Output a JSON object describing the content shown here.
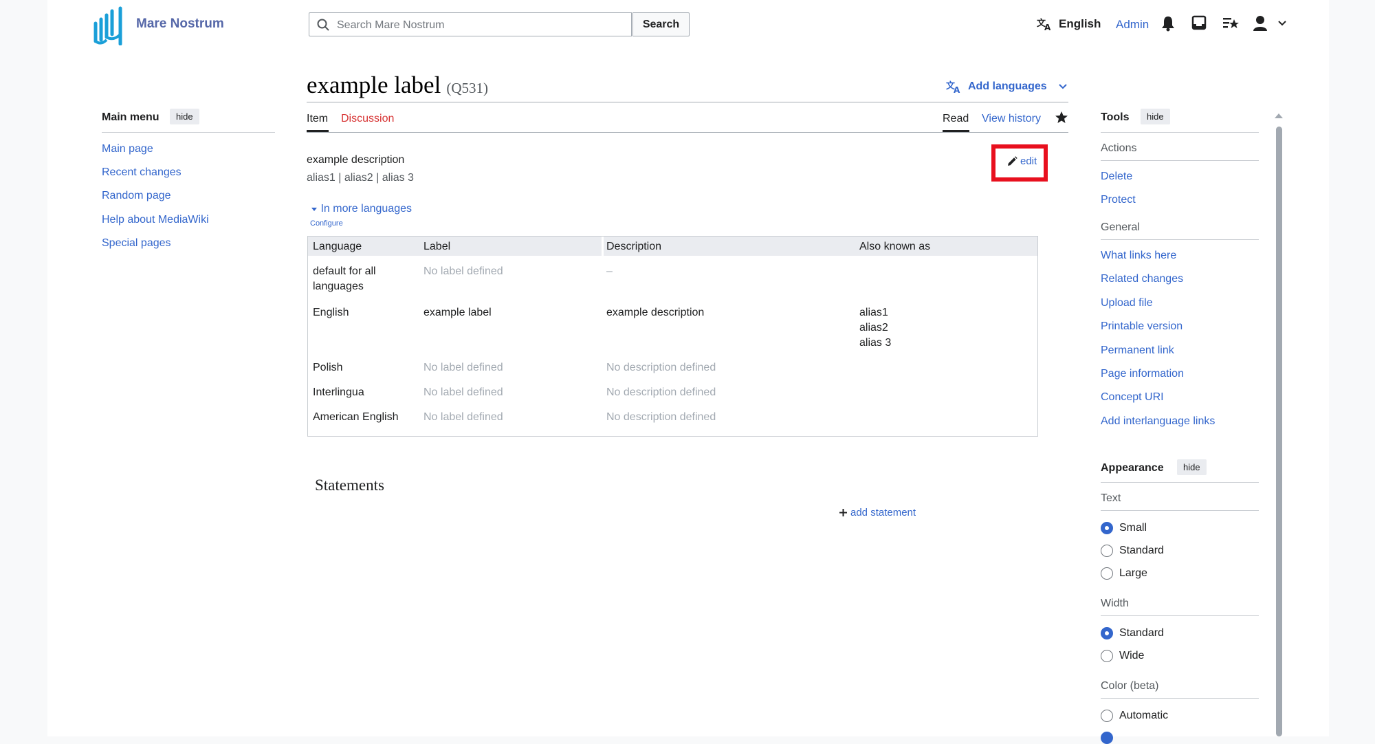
{
  "header": {
    "site_name": "Mare Nostrum",
    "search_placeholder": "Search Mare Nostrum",
    "search_button": "Search",
    "language": "English",
    "user": "Admin"
  },
  "main_menu": {
    "title": "Main menu",
    "hide": "hide",
    "items": [
      "Main page",
      "Recent changes",
      "Random page",
      "Help about MediaWiki",
      "Special pages"
    ]
  },
  "page": {
    "title": "example label",
    "qid": "(Q531)",
    "add_languages": "Add languages",
    "tabs": {
      "item": "Item",
      "discussion": "Discussion",
      "read": "Read",
      "history": "View history"
    },
    "description": "example description",
    "aliases": "alias1 | alias2 | alias 3",
    "edit": "edit",
    "more_languages": "In more languages",
    "configure": "Configure"
  },
  "lang_table": {
    "headers": [
      "Language",
      "Label",
      "Description",
      "Also known as"
    ],
    "rows": [
      {
        "language": "default for all languages",
        "label": "No label defined",
        "description": "–",
        "aliases": ""
      },
      {
        "language": "English",
        "label": "example label",
        "description": "example description",
        "aliases": "alias1\nalias2\nalias 3"
      },
      {
        "language": "Polish",
        "label": "No label defined",
        "description": "No description defined",
        "aliases": ""
      },
      {
        "language": "Interlingua",
        "label": "No label defined",
        "description": "No description defined",
        "aliases": ""
      },
      {
        "language": "American English",
        "label": "No label defined",
        "description": "No description defined",
        "aliases": ""
      }
    ]
  },
  "statements": {
    "heading": "Statements",
    "add": "add statement"
  },
  "tools": {
    "title": "Tools",
    "hide": "hide",
    "actions_heading": "Actions",
    "actions": [
      "Delete",
      "Protect"
    ],
    "general_heading": "General",
    "general": [
      "What links here",
      "Related changes",
      "Upload file",
      "Printable version",
      "Permanent link",
      "Page information",
      "Concept URI",
      "Add interlanguage links"
    ]
  },
  "appearance": {
    "title": "Appearance",
    "hide": "hide",
    "text_heading": "Text",
    "text_options": [
      "Small",
      "Standard",
      "Large"
    ],
    "text_selected": "Small",
    "width_heading": "Width",
    "width_options": [
      "Standard",
      "Wide"
    ],
    "width_selected": "Standard",
    "color_heading": "Color (beta)",
    "color_options": [
      "Automatic"
    ]
  },
  "colors": {
    "link": "#3366cc",
    "discussion": "#d73333",
    "highlight": "#e8101e"
  }
}
